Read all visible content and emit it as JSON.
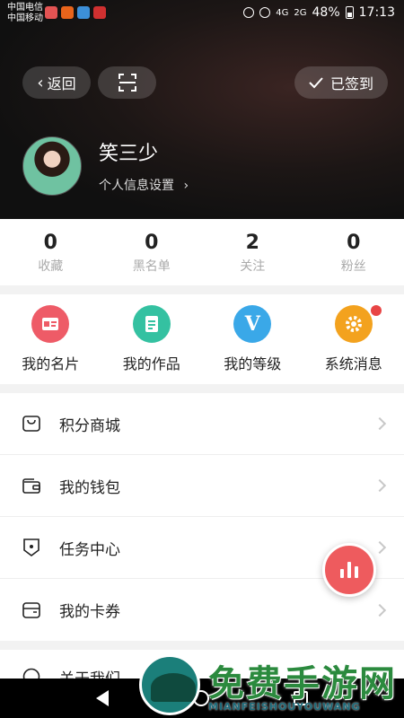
{
  "status_bar": {
    "carrier1": "中国电信",
    "carrier2": "中国移动",
    "network": "4G",
    "network2": "2G",
    "battery_percent": "48%",
    "time": "17:13"
  },
  "header": {
    "back_label": "返回",
    "signed_in_label": "已签到",
    "username": "笑三少",
    "profile_settings_label": "个人信息设置"
  },
  "stats": [
    {
      "value": "0",
      "label": "收藏"
    },
    {
      "value": "0",
      "label": "黑名单"
    },
    {
      "value": "2",
      "label": "关注"
    },
    {
      "value": "0",
      "label": "粉丝"
    }
  ],
  "quick_links": [
    {
      "label": "我的名片",
      "icon": "card-icon",
      "color": "#ee5b67"
    },
    {
      "label": "我的作品",
      "icon": "document-icon",
      "color": "#34c1a1"
    },
    {
      "label": "我的等级",
      "icon": "v-badge-icon",
      "color": "#3aa8e8",
      "glyph": "V"
    },
    {
      "label": "系统消息",
      "icon": "gear-icon",
      "color": "#f3a21e"
    }
  ],
  "menu": [
    {
      "label": "积分商城",
      "icon": "shopping-bag-icon"
    },
    {
      "label": "我的钱包",
      "icon": "wallet-icon"
    },
    {
      "label": "任务中心",
      "icon": "task-icon"
    },
    {
      "label": "我的卡券",
      "icon": "coupon-icon"
    }
  ],
  "about_label": "关于我们",
  "watermark": {
    "title": "免费手游网",
    "subtitle": "MIANFEISHOUYOUWANG"
  }
}
